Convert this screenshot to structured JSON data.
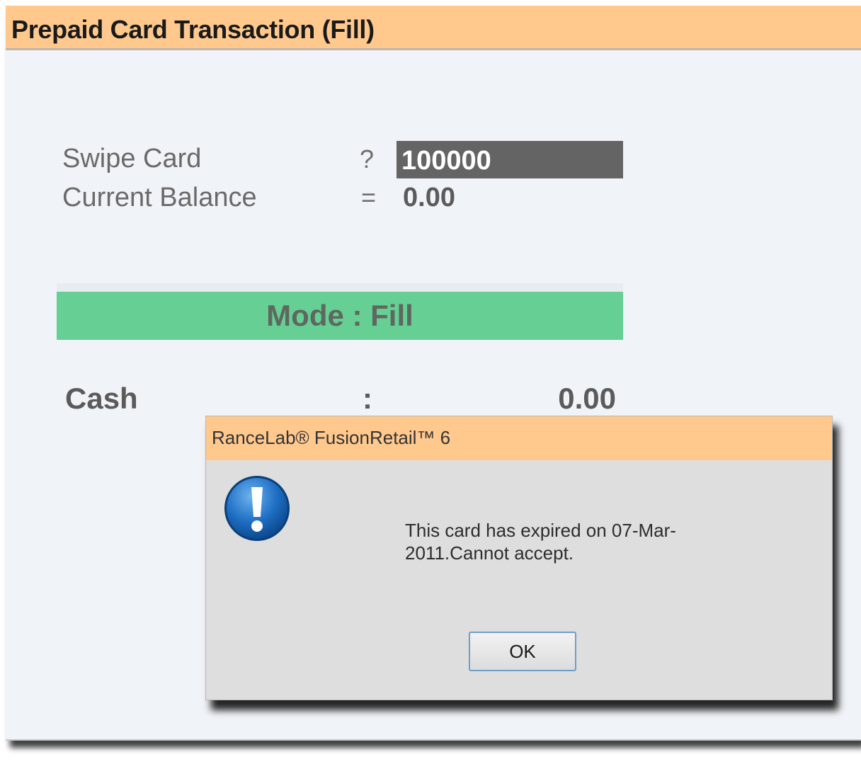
{
  "window": {
    "title": "Prepaid Card Transaction (Fill)"
  },
  "form": {
    "swipe_card_label": "Swipe Card",
    "swipe_card_symbol": "?",
    "swipe_card_value": "100000",
    "balance_label": "Current Balance",
    "balance_symbol": "=",
    "balance_value": "0.00"
  },
  "mode": {
    "label": "Mode : Fill"
  },
  "cash": {
    "label": "Cash",
    "separator": ":",
    "value": "0.00"
  },
  "dialog": {
    "title": "RanceLab® FusionRetail™ 6",
    "message": "This card has expired on 07-Mar-2011.Cannot accept.",
    "ok_label": "OK",
    "icon": "info-exclamation-icon"
  },
  "colors": {
    "title_bar": "#ffc98e",
    "mode_bar": "#66cf94",
    "input_bg": "#646464",
    "window_bg": "#f0f3f8",
    "dialog_bg": "#dedede"
  }
}
